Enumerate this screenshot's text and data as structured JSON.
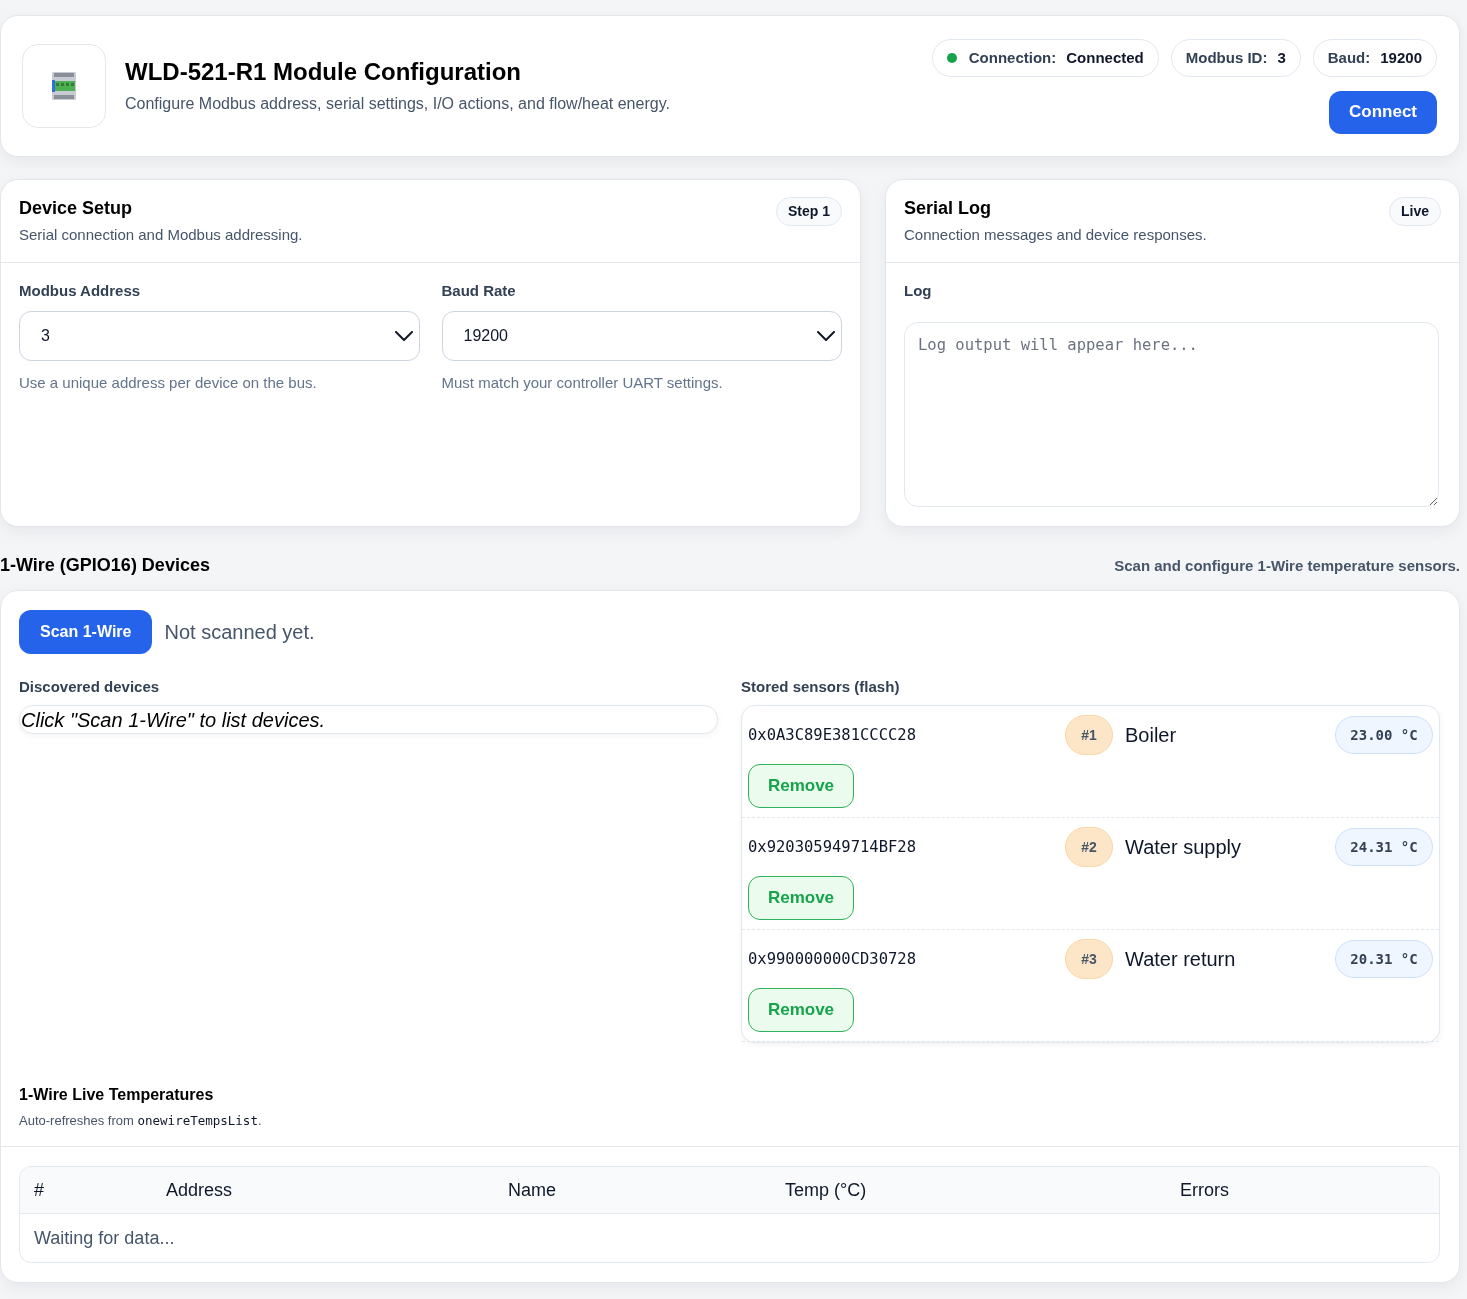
{
  "header": {
    "title": "WLD-521-R1 Module Configuration",
    "subtitle": "Configure Modbus address, serial settings, I/O actions, and flow/heat energy.",
    "status": [
      {
        "kind": "connection",
        "label": "Connection:",
        "value": "Connected",
        "color": "#16a34a"
      },
      {
        "kind": "plain",
        "label": "Modbus ID:",
        "value": "3"
      },
      {
        "kind": "plain",
        "label": "Baud:",
        "value": "19200"
      }
    ],
    "connect_button": "Connect"
  },
  "device_setup": {
    "title": "Device Setup",
    "subtitle": "Serial connection and Modbus addressing.",
    "badge": "Step 1",
    "fields": [
      {
        "label": "Modbus Address",
        "value": "3",
        "hint": "Use a unique address per device on the bus."
      },
      {
        "label": "Baud Rate",
        "value": "19200",
        "hint": "Must match your controller UART settings."
      }
    ]
  },
  "serial_log": {
    "title": "Serial Log",
    "subtitle": "Connection messages and device responses.",
    "badge": "Live",
    "log": {
      "label": "Log",
      "placeholder": "Log output will appear here..."
    }
  },
  "onewire": {
    "title": "1-Wire (GPIO16) Devices",
    "description": "Scan and configure 1-Wire temperature sensors.",
    "scan_button": "Scan 1-Wire",
    "scan_status": "Not scanned yet.",
    "discovered": {
      "label": "Discovered devices",
      "empty_text": "Click \"Scan 1-Wire\" to list devices."
    },
    "stored": {
      "label": "Stored sensors (flash)",
      "sensors": [
        {
          "address": "0x0A3C89E381CCCC28",
          "number": "#1",
          "name": "Boiler",
          "temperature": "23.00 °C",
          "remove_button": "Remove"
        },
        {
          "address": "0x920305949714BF28",
          "number": "#2",
          "name": "Water supply",
          "temperature": "24.31 °C",
          "remove_button": "Remove"
        },
        {
          "address": "0x990000000CD30728",
          "number": "#3",
          "name": "Water return",
          "temperature": "20.31 °C",
          "remove_button": "Remove"
        }
      ]
    },
    "live": {
      "title": "1-Wire Live Temperatures",
      "note": {
        "text": "Auto-refreshes from ",
        "code": "onewireTempsList",
        "suffix": "."
      },
      "table": {
        "columns": [
          "#",
          "Address",
          "Name",
          "Temp (°C)",
          "Errors"
        ],
        "empty_text": "Waiting for data..."
      }
    }
  }
}
